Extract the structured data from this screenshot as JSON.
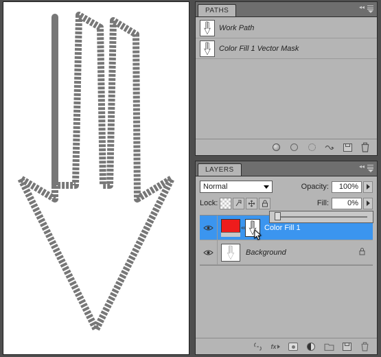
{
  "paths_panel": {
    "title": "PATHS",
    "items": [
      {
        "label": "Work Path"
      },
      {
        "label": "Color Fill 1 Vector Mask"
      }
    ],
    "footer_icons": [
      "fill-path-icon",
      "stroke-path-icon",
      "path-to-selection-icon",
      "selection-to-path-icon",
      "new-path-icon",
      "delete-path-icon"
    ]
  },
  "layers_panel": {
    "title": "LAYERS",
    "blend_mode": "Normal",
    "opacity_label": "Opacity:",
    "opacity_value": "100%",
    "lock_label": "Lock:",
    "fill_label": "Fill:",
    "fill_value": "0%",
    "layers": [
      {
        "label": "Color Fill 1",
        "swatch_color": "#ee1c1c",
        "selected": true
      },
      {
        "label": "Background",
        "locked": true
      }
    ],
    "footer_icons": [
      "link-layers-icon",
      "fx-icon",
      "mask-icon",
      "adjustment-icon",
      "group-icon",
      "new-layer-icon",
      "delete-layer-icon"
    ]
  }
}
